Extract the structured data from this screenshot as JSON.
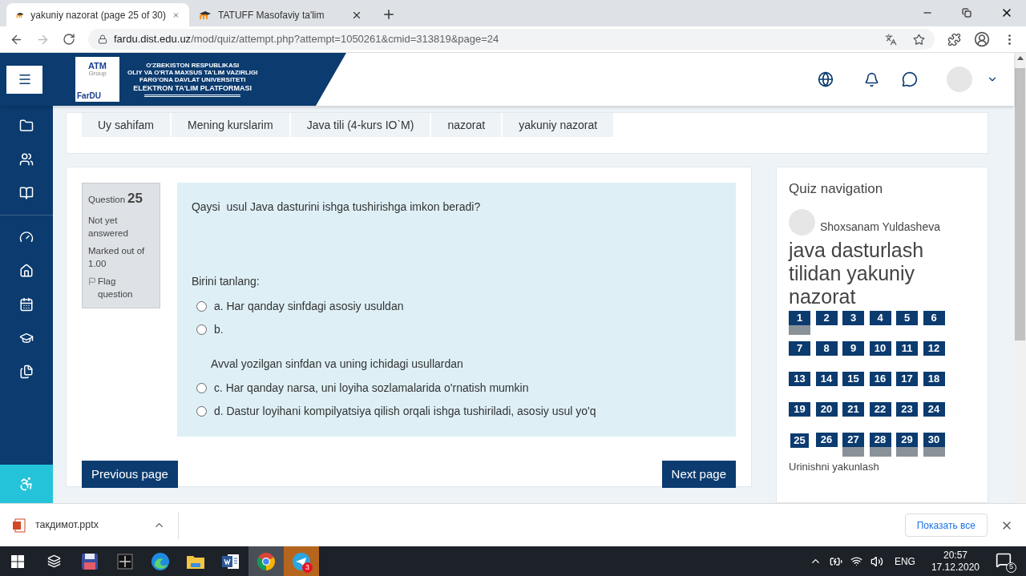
{
  "browser": {
    "tabs": [
      {
        "title": "yakuniy nazorat (page 25 of 30)",
        "selected": true
      },
      {
        "title": "TATUFF Masofaviy ta'lim",
        "selected": false
      }
    ],
    "url": {
      "host": "fardu.dist.edu.uz",
      "path": "/mod/quiz/attempt.php?attempt=1050261&cmid=313819&page=24"
    }
  },
  "header": {
    "logo": {
      "mark": "ATM",
      "group": "Group",
      "name": "FarDU"
    },
    "lines": [
      "O'ZBEKISTON RESPUBLIKASI",
      "OLIY VA O'RTA MAXSUS TA'LIM VAZIRLIGI",
      "FARG'ONA DAVLAT UNIVERSITETI",
      "ELEKTRON TA'LIM PLATFORMASI"
    ]
  },
  "breadcrumb": [
    "Uy sahifam",
    "Mening kurslarim",
    "Java tili (4-kurs IO`M)",
    "nazorat",
    "yakuniy nazorat"
  ],
  "question": {
    "label": "Question",
    "number": "25",
    "status": "Not yet answered",
    "marks": "Marked out of 1.00",
    "flag": "Flag question",
    "text": "Qaysi  usul Java dasturini ishga tushirishga imkon beradi?",
    "prompt": "Birini tanlang:",
    "options": [
      {
        "label": "a. Har qanday sinfdagi asosiy usuldan",
        "selected": false
      },
      {
        "label": "b.",
        "selected": false,
        "extra": "Avval yozilgan sinfdan va uning ichidagi usullardan"
      },
      {
        "label": "c. Har qanday narsa, uni loyiha sozlamalarida o'rnatish mumkin",
        "selected": false
      },
      {
        "label": "d. Dastur loyihani kompilyatsiya qilish orqali ishga tushiriladi, asosiy usul yo'q",
        "selected": false
      }
    ]
  },
  "buttons": {
    "previous": "Previous page",
    "next": "Next page"
  },
  "quiz_nav": {
    "title": "Quiz navigation",
    "user": "Shoxsanam Yuldasheva",
    "heading": "java dasturlash tilidan yakuniy nazorat",
    "questions": [
      {
        "label": "1",
        "answered": true,
        "current": false
      },
      {
        "label": "2",
        "answered": false,
        "current": false
      },
      {
        "label": "3",
        "answered": false,
        "current": false
      },
      {
        "label": "4",
        "answered": false,
        "current": false
      },
      {
        "label": "5",
        "answered": false,
        "current": false
      },
      {
        "label": "6",
        "answered": false,
        "current": false
      },
      {
        "label": "7",
        "answered": false,
        "current": false
      },
      {
        "label": "8",
        "answered": false,
        "current": false
      },
      {
        "label": "9",
        "answered": false,
        "current": false
      },
      {
        "label": "10",
        "answered": false,
        "current": false
      },
      {
        "label": "11",
        "answered": false,
        "current": false
      },
      {
        "label": "12",
        "answered": false,
        "current": false
      },
      {
        "label": "13",
        "answered": false,
        "current": false
      },
      {
        "label": "14",
        "answered": false,
        "current": false
      },
      {
        "label": "15",
        "answered": false,
        "current": false
      },
      {
        "label": "16",
        "answered": false,
        "current": false
      },
      {
        "label": "17",
        "answered": false,
        "current": false
      },
      {
        "label": "18",
        "answered": false,
        "current": false
      },
      {
        "label": "19",
        "answered": false,
        "current": false
      },
      {
        "label": "20",
        "answered": false,
        "current": false
      },
      {
        "label": "21",
        "answered": false,
        "current": false
      },
      {
        "label": "22",
        "answered": false,
        "current": false
      },
      {
        "label": "23",
        "answered": false,
        "current": false
      },
      {
        "label": "24",
        "answered": false,
        "current": false
      },
      {
        "label": "25",
        "answered": false,
        "current": true
      },
      {
        "label": "26",
        "answered": false,
        "current": false
      },
      {
        "label": "27",
        "answered": true,
        "current": false
      },
      {
        "label": "28",
        "answered": true,
        "current": false
      },
      {
        "label": "29",
        "answered": true,
        "current": false
      },
      {
        "label": "30",
        "answered": true,
        "current": false
      }
    ],
    "finish": "Urinishni yakunlash"
  },
  "download": {
    "file": "такдимот.pptx",
    "show_all": "Показать все"
  },
  "taskbar": {
    "apps": [
      {
        "kind": "save",
        "active": false
      },
      {
        "kind": "grid",
        "active": false
      },
      {
        "kind": "edge",
        "active": false
      },
      {
        "kind": "folder",
        "active": false
      },
      {
        "kind": "word",
        "active": false
      },
      {
        "kind": "chrome",
        "active": true
      },
      {
        "kind": "telegram",
        "active": false,
        "badge": "3"
      }
    ],
    "lang": "ENG",
    "time": "20:57",
    "date": "17.12.2020",
    "notifications": "5"
  }
}
